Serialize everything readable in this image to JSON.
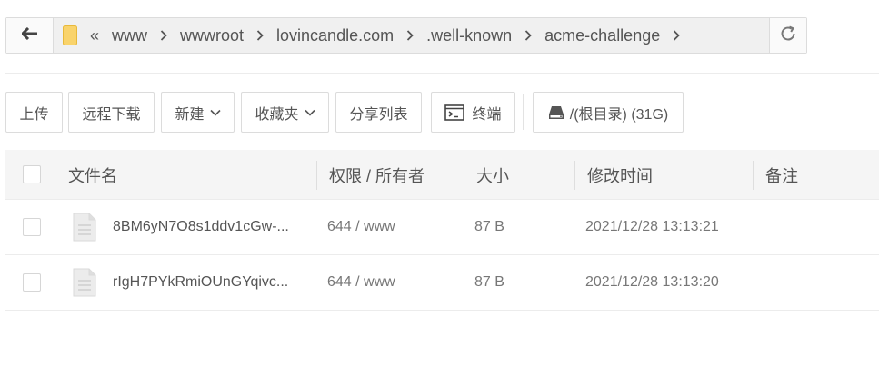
{
  "nav": {
    "back_icon": "arrow-left-icon",
    "folder_icon": "folder-icon",
    "collapse_icon": "double-chevron-left-icon",
    "crumbs": [
      "www",
      "wwwroot",
      "lovincandle.com",
      ".well-known",
      "acme-challenge"
    ],
    "refresh_icon": "refresh-icon"
  },
  "toolbar": {
    "upload": "上传",
    "remote_download": "远程下载",
    "new": "新建",
    "favorites": "收藏夹",
    "share_list": "分享列表",
    "terminal": "终端",
    "disk": "/(根目录) (31G)"
  },
  "table": {
    "columns": {
      "name": "文件名",
      "perm": "权限 / 所有者",
      "size": "大小",
      "mtime": "修改时间",
      "note": "备注"
    },
    "rows": [
      {
        "name": "8BM6yN7O8s1ddv1cGw-...",
        "perm": "644 / www",
        "size": "87 B",
        "mtime": "2021/12/28 13:13:21",
        "note": ""
      },
      {
        "name": "rIgH7PYkRmiOUnGYqivc...",
        "perm": "644 / www",
        "size": "87 B",
        "mtime": "2021/12/28 13:13:20",
        "note": ""
      }
    ]
  },
  "colors": {
    "folder": "#f9d36b",
    "border": "#dcdcdc",
    "header_bg": "#f5f5f5",
    "text": "#555555"
  }
}
